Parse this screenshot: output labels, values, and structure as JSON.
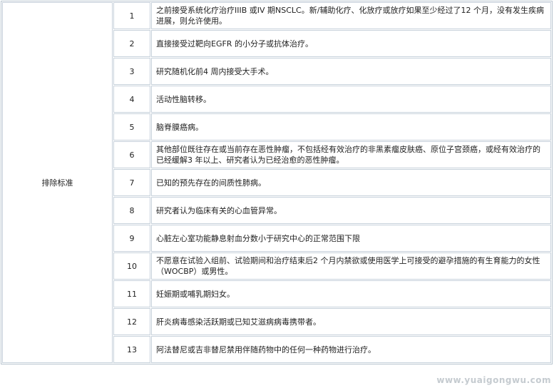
{
  "section_label": "排除标准",
  "rows": [
    {
      "num": "1",
      "text": "之前接受系统化疗治疗IIIB 或IV 期NSCLC。新/辅助化疗、化放疗或放疗如果至少经过了12 个月，没有发生疾病进展，则允许使用。"
    },
    {
      "num": "2",
      "text": "直接接受过靶向EGFR 的小分子或抗体治疗。"
    },
    {
      "num": "3",
      "text": "研究随机化前4 周内接受大手术。"
    },
    {
      "num": "4",
      "text": "活动性脑转移。"
    },
    {
      "num": "5",
      "text": "脑脊膜癌病。"
    },
    {
      "num": "6",
      "text": "其他部位既往存在或当前存在恶性肿瘤，不包括经有效治疗的非黑素瘤皮肤癌、原位子宫颈癌，或经有效治疗的已经缓解3 年以上、研究者认为已经治愈的恶性肿瘤。"
    },
    {
      "num": "7",
      "text": "已知的预先存在的间质性肺病。"
    },
    {
      "num": "8",
      "text": "研究者认为临床有关的心血管异常。"
    },
    {
      "num": "9",
      "text": "心脏左心室功能静息射血分数小于研究中心的正常范围下限"
    },
    {
      "num": "10",
      "text": "不愿意在试验入组前、试验期间和治疗结束后2 个月内禁欲或使用医学上可接受的避孕措施的有生育能力的女性（WOCBP）或男性。"
    },
    {
      "num": "11",
      "text": "妊娠期或哺乳期妇女。"
    },
    {
      "num": "12",
      "text": "肝炎病毒感染活跃期或已知艾滋病病毒携带者。"
    },
    {
      "num": "13",
      "text": "阿法替尼或吉非替尼禁用伴随药物中的任何一种药物进行治疗。"
    }
  ],
  "watermark": "www.yuaigongwu.com"
}
